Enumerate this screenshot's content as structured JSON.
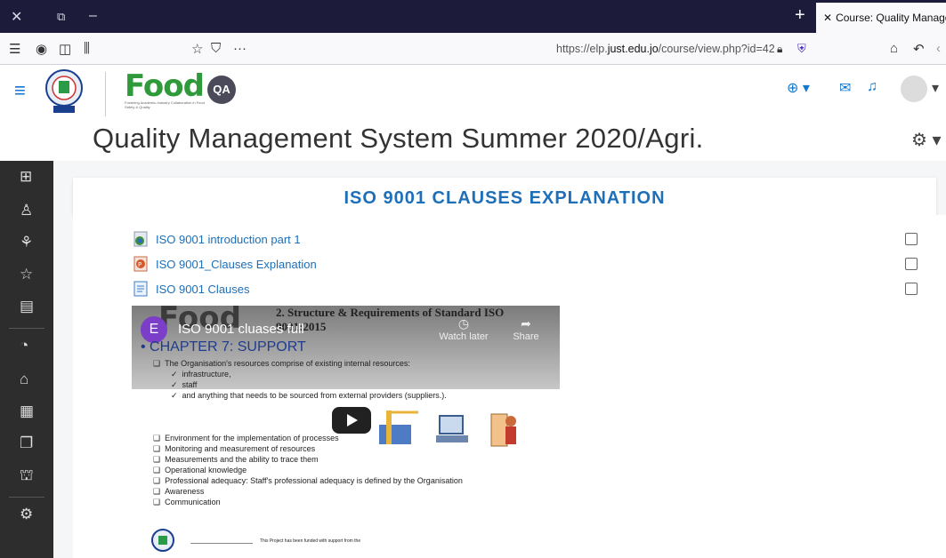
{
  "browser": {
    "tab_title": "Course: Quality Management",
    "new_tab_icon": "+",
    "url_prefix": "https://elp.",
    "url_domain": "just.edu.jo",
    "url_path": "/course/view.php?id=42"
  },
  "header": {
    "food_logo_text": "Food",
    "qa_badge": "QA",
    "food_tagline": "Fostering Academic-Industry Collaboration in Food Safety & Quality",
    "course_title": "Quality Management System Summer 2020/Agri."
  },
  "section": {
    "title": "ISO 9001 CLAUSES EXPLANATION"
  },
  "activities": [
    {
      "label": "ISO 9001 introduction part 1",
      "icon": "video-file-icon"
    },
    {
      "label": "ISO 9001_Clauses Explanation",
      "icon": "powerpoint-file-icon"
    },
    {
      "label": "ISO 9001 Clauses",
      "icon": "page-icon"
    }
  ],
  "video": {
    "channel_initial": "E",
    "title": "ISO 9001 cluases full",
    "watch_later": "Watch later",
    "share": "Share",
    "slide_logo": "Food",
    "slide_header": "2. Structure & Requirements of Standard ISO 9001:2015",
    "chapter": "CHAPTER 7: SUPPORT",
    "lines": [
      "The Organisation's resources comprise of existing internal resources:",
      "infrastructure,",
      "staff",
      "and anything that needs to be sourced from external providers (suppliers.)."
    ],
    "bullets": [
      "Environment for the implementation of processes",
      "Monitoring and measurement of resources",
      "Measurements and  the ability to trace them",
      "Operational knowledge",
      "Professional adequacy:  Staff's professional adequacy is defined by the Organisation",
      "Awareness",
      "Communication"
    ],
    "footer": "This Project has been funded with support from the"
  }
}
